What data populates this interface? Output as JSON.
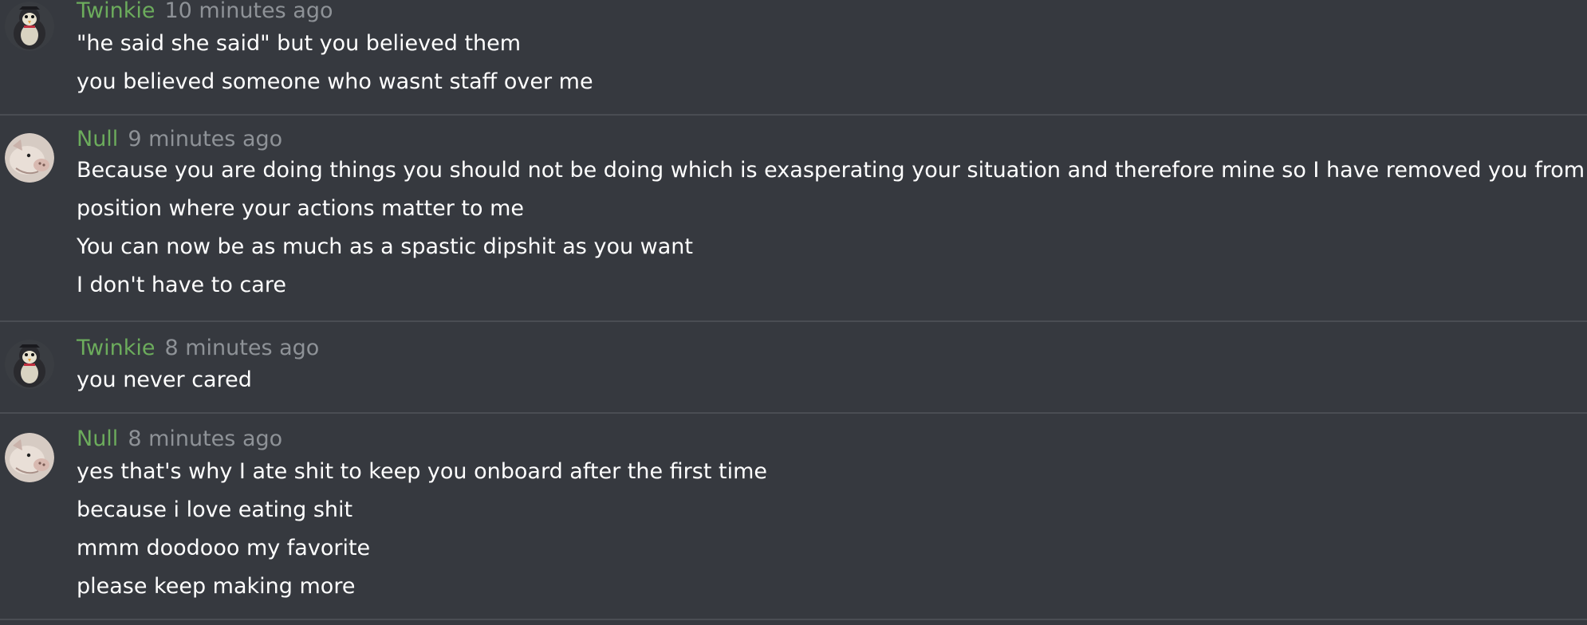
{
  "colors": {
    "background": "#36393f",
    "username": "#6cac5c",
    "timestamp": "#8e9297",
    "message_text": "#ffffff",
    "divider": "#4a4d53"
  },
  "messages": [
    {
      "author": "Twinkie",
      "timestamp": "10 minutes ago",
      "avatar_icon": "penguin-avatar-icon",
      "lines": [
        "\"he said she said\" but you believed them",
        "you believed someone who wasnt staff over me"
      ]
    },
    {
      "author": "Null",
      "timestamp": "9 minutes ago",
      "avatar_icon": "pig-avatar-icon",
      "lines": [
        "Because you are doing things you should not be doing which is exasperating your situation and therefore mine so I have removed you from a",
        "position where your actions matter to me",
        "You can now be as much as a spastic dipshit as you want",
        "I don't have to care"
      ]
    },
    {
      "author": "Twinkie",
      "timestamp": "8 minutes ago",
      "avatar_icon": "penguin-avatar-icon",
      "lines": [
        "you never cared"
      ]
    },
    {
      "author": "Null",
      "timestamp": "8 minutes ago",
      "avatar_icon": "pig-avatar-icon",
      "lines": [
        "yes that's why I ate shit to keep you onboard after the first time",
        "because i love eating shit",
        "mmm doodooo my favorite",
        "please keep making more"
      ]
    }
  ]
}
